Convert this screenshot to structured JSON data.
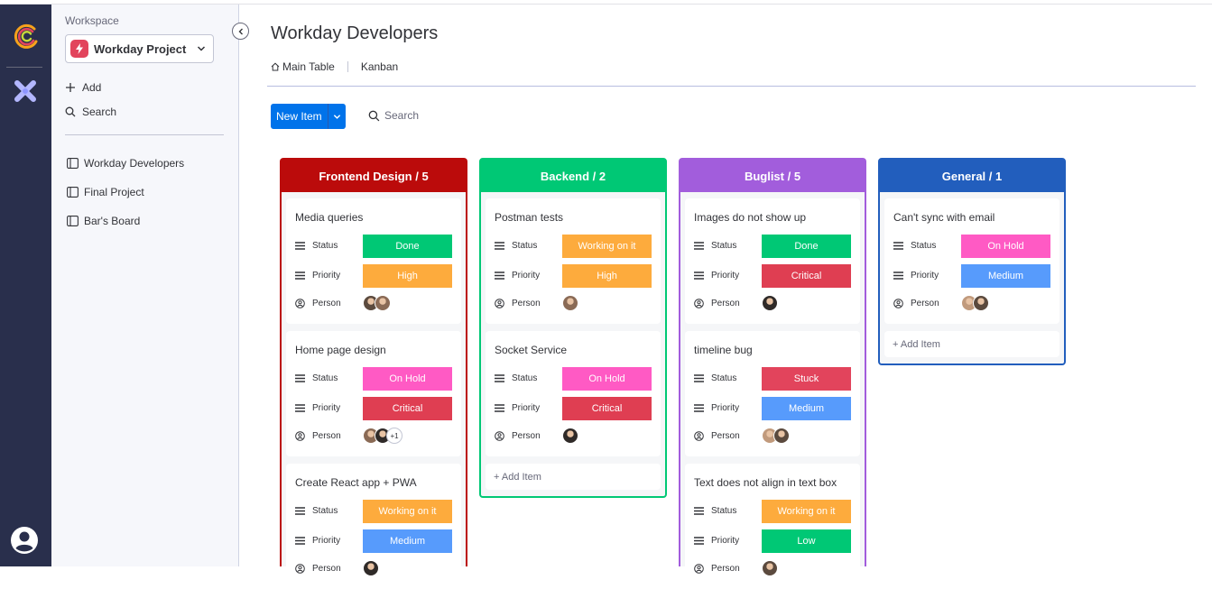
{
  "workspace": {
    "label": "Workspace",
    "selected": "Workday Project",
    "add_label": "Add",
    "search_label": "Search",
    "boards": [
      "Workday Developers",
      "Final Project",
      "Bar's Board"
    ]
  },
  "header": {
    "title": "Workday Developers",
    "views": [
      "Main Table",
      "Kanban"
    ]
  },
  "toolbar": {
    "new_item_label": "New Item",
    "search_label": "Search"
  },
  "field_labels": {
    "status": "Status",
    "priority": "Priority",
    "person": "Person"
  },
  "add_item_label": "+ Add Item",
  "colors": {
    "done": "#00c875",
    "working": "#fdab3d",
    "stuck": "#e2445c",
    "onhold": "#ff5ac4",
    "critical": "#df3e52",
    "high": "#fdab3d",
    "medium": "#579bfc",
    "low": "#00c875",
    "frontend": "#bb0b0b",
    "backend": "#00c875",
    "buglist": "#a25ddc",
    "general": "#225ebd"
  },
  "columns": [
    {
      "title": "Frontend Design / 5",
      "color": "frontend",
      "cards": [
        {
          "title": "Media queries",
          "status": "Done",
          "status_color": "done",
          "priority": "High",
          "priority_color": "high",
          "people": 2,
          "extra": ""
        },
        {
          "title": "Home page design",
          "status": "On Hold",
          "status_color": "onhold",
          "priority": "Critical",
          "priority_color": "critical",
          "people": 2,
          "extra": "+1"
        },
        {
          "title": "Create React app + PWA",
          "status": "Working on it",
          "status_color": "working",
          "priority": "Medium",
          "priority_color": "medium",
          "people": 1,
          "extra": ""
        }
      ],
      "show_add": false
    },
    {
      "title": "Backend / 2",
      "color": "backend",
      "cards": [
        {
          "title": "Postman tests",
          "status": "Working on it",
          "status_color": "working",
          "priority": "High",
          "priority_color": "high",
          "people": 1,
          "extra": ""
        },
        {
          "title": "Socket Service",
          "status": "On Hold",
          "status_color": "onhold",
          "priority": "Critical",
          "priority_color": "critical",
          "people": 1,
          "extra": ""
        }
      ],
      "show_add": true
    },
    {
      "title": "Buglist / 5",
      "color": "buglist",
      "cards": [
        {
          "title": "Images do not show up",
          "status": "Done",
          "status_color": "done",
          "priority": "Critical",
          "priority_color": "critical",
          "people": 1,
          "extra": ""
        },
        {
          "title": "timeline bug",
          "status": "Stuck",
          "status_color": "stuck",
          "priority": "Medium",
          "priority_color": "medium",
          "people": 2,
          "extra": ""
        },
        {
          "title": "Text does not align in text box",
          "status": "Working on it",
          "status_color": "working",
          "priority": "Low",
          "priority_color": "low",
          "people": 1,
          "extra": ""
        }
      ],
      "show_add": false
    },
    {
      "title": "General / 1",
      "color": "general",
      "cards": [
        {
          "title": "Can't sync with email",
          "status": "On Hold",
          "status_color": "onhold",
          "priority": "Medium",
          "priority_color": "medium",
          "people": 2,
          "extra": ""
        }
      ],
      "show_add": true
    }
  ]
}
